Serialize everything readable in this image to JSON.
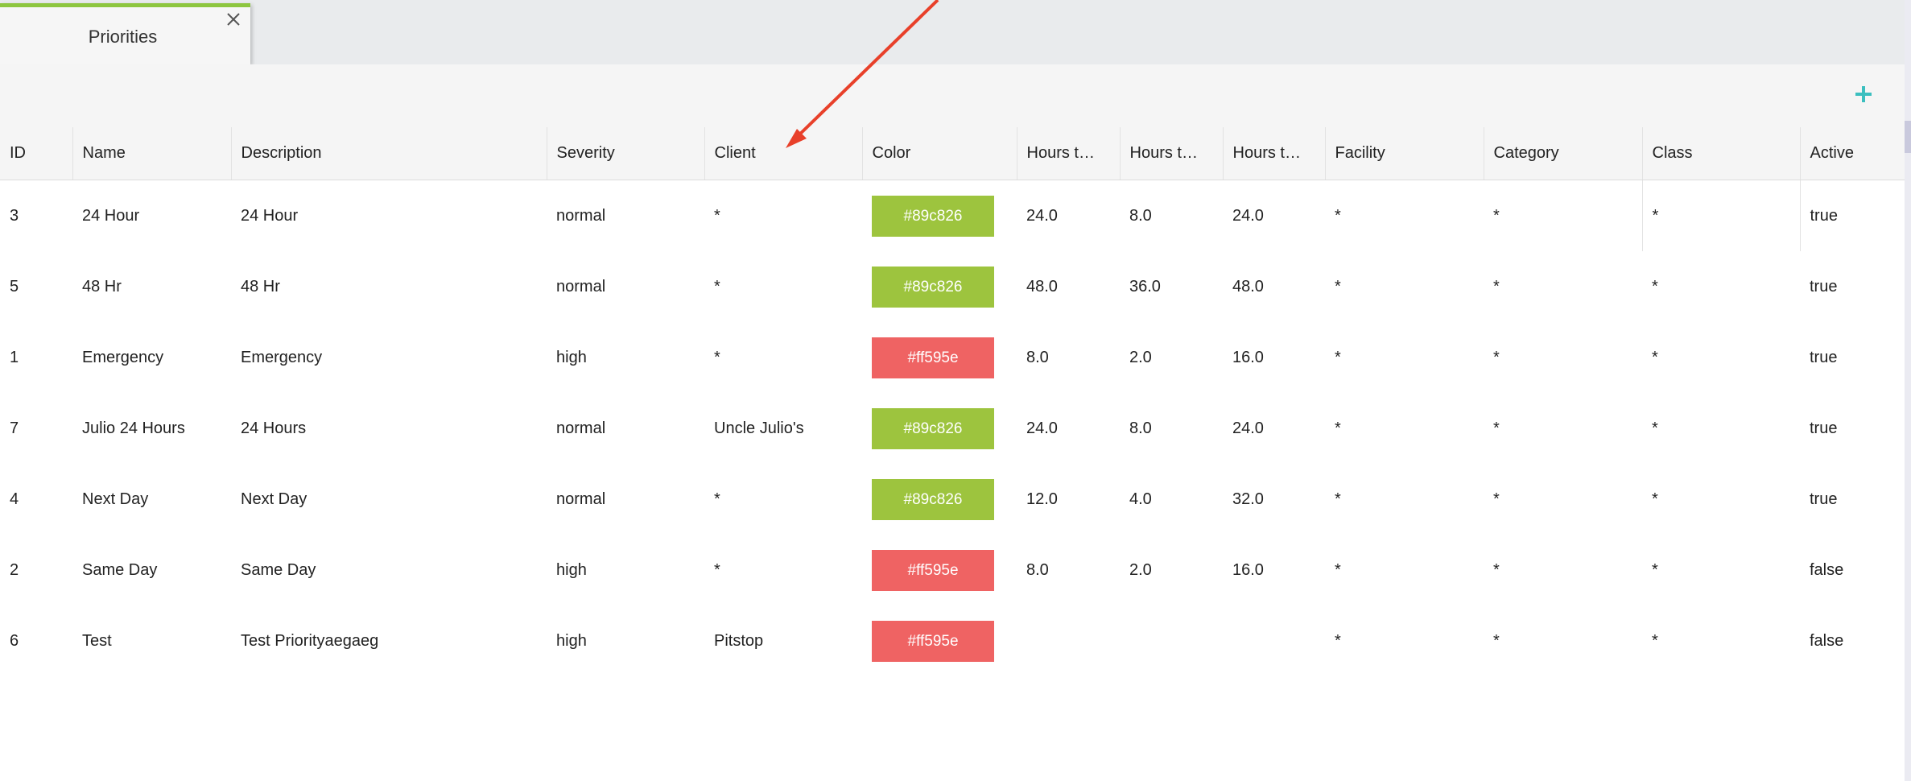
{
  "tab": {
    "title": "Priorities"
  },
  "toolbar": {
    "add_icon": "plus-icon",
    "add_color": "#3bbfbf"
  },
  "columns": [
    "ID",
    "Name",
    "Description",
    "Severity",
    "Client",
    "Color",
    "Hours t…",
    "Hours t…",
    "Hours t…",
    "Facility",
    "Category",
    "Class",
    "Active"
  ],
  "rows": [
    {
      "id": "3",
      "name": "24 Hour",
      "description": "24 Hour",
      "severity": "normal",
      "client": "*",
      "color": "#89c826",
      "h1": "24.0",
      "h2": "8.0",
      "h3": "24.0",
      "facility": "*",
      "category": "*",
      "class": "*",
      "active": "true"
    },
    {
      "id": "5",
      "name": "48 Hr",
      "description": "48 Hr",
      "severity": "normal",
      "client": "*",
      "color": "#89c826",
      "h1": "48.0",
      "h2": "36.0",
      "h3": "48.0",
      "facility": "*",
      "category": "*",
      "class": "*",
      "active": "true"
    },
    {
      "id": "1",
      "name": "Emergency",
      "description": "Emergency",
      "severity": "high",
      "client": "*",
      "color": "#ff595e",
      "h1": "8.0",
      "h2": "2.0",
      "h3": "16.0",
      "facility": "*",
      "category": "*",
      "class": "*",
      "active": "true"
    },
    {
      "id": "7",
      "name": "Julio 24 Hours",
      "description": "24 Hours",
      "severity": "normal",
      "client": "Uncle Julio's",
      "color": "#89c826",
      "h1": "24.0",
      "h2": "8.0",
      "h3": "24.0",
      "facility": "*",
      "category": "*",
      "class": "*",
      "active": "true"
    },
    {
      "id": "4",
      "name": "Next Day",
      "description": "Next Day",
      "severity": "normal",
      "client": "*",
      "color": "#89c826",
      "h1": "12.0",
      "h2": "4.0",
      "h3": "32.0",
      "facility": "*",
      "category": "*",
      "class": "*",
      "active": "true"
    },
    {
      "id": "2",
      "name": "Same Day",
      "description": "Same Day",
      "severity": "high",
      "client": "*",
      "color": "#ff595e",
      "h1": "8.0",
      "h2": "2.0",
      "h3": "16.0",
      "facility": "*",
      "category": "*",
      "class": "*",
      "active": "false"
    },
    {
      "id": "6",
      "name": "Test",
      "description": "Test Priorityaegaeg",
      "severity": "high",
      "client": "Pitstop",
      "color": "#ff595e",
      "h1": "",
      "h2": "",
      "h3": "",
      "facility": "*",
      "category": "*",
      "class": "*",
      "active": "false"
    }
  ],
  "annotation": {
    "icon": "red-arrow-annotation",
    "color": "#e8402a"
  },
  "colors": {
    "tab_accent": "#8dc63f",
    "green_swatch_bg": "#9dc43e",
    "red_swatch_bg": "#ef6363"
  }
}
